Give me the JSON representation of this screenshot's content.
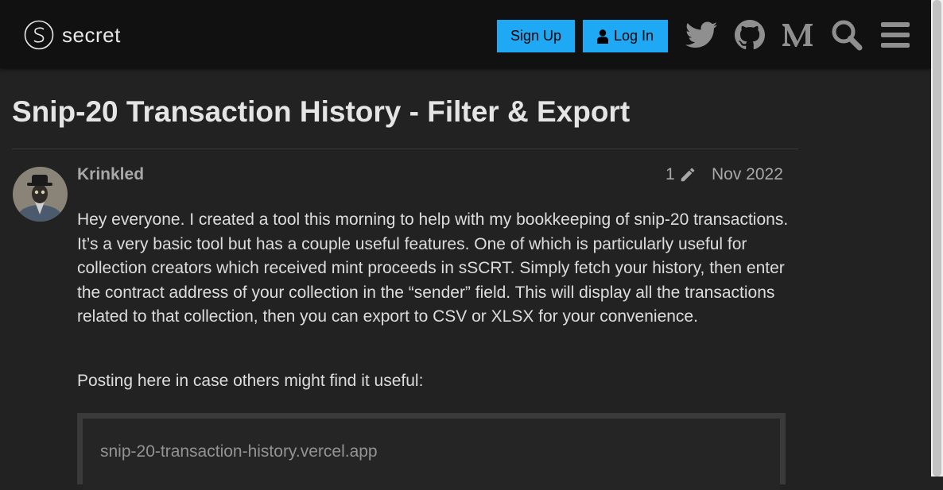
{
  "header": {
    "logo_text": "secret",
    "signup_label": "Sign Up",
    "login_label": "Log In",
    "icons": [
      "twitter-icon",
      "github-icon",
      "medium-icon",
      "search-icon",
      "menu-icon"
    ]
  },
  "topic": {
    "title": "Snip-20 Transaction History - Filter & Export"
  },
  "post": {
    "username": "Krinkled",
    "edit_count": "1",
    "date": "Nov 2022",
    "paragraph1": "Hey everyone. I created a tool this morning to help with my bookkeeping of snip-20 transactions. It’s a very basic tool but has a couple useful features. One of which is particularly useful for collection creators which received mint proceeds in sSCRT. Simply fetch your history, then enter the contract address of your collection in the “sender” field. This will display all the transactions related to that collection, then you can export to CSV or XLSX for your convenience.",
    "paragraph2": "Posting here in case others might find it useful:",
    "onebox_link": "snip-20-transaction-history.vercel.app"
  },
  "colors": {
    "header_bg": "#111111",
    "page_bg": "#222222",
    "accent": "#1fa9f4"
  }
}
